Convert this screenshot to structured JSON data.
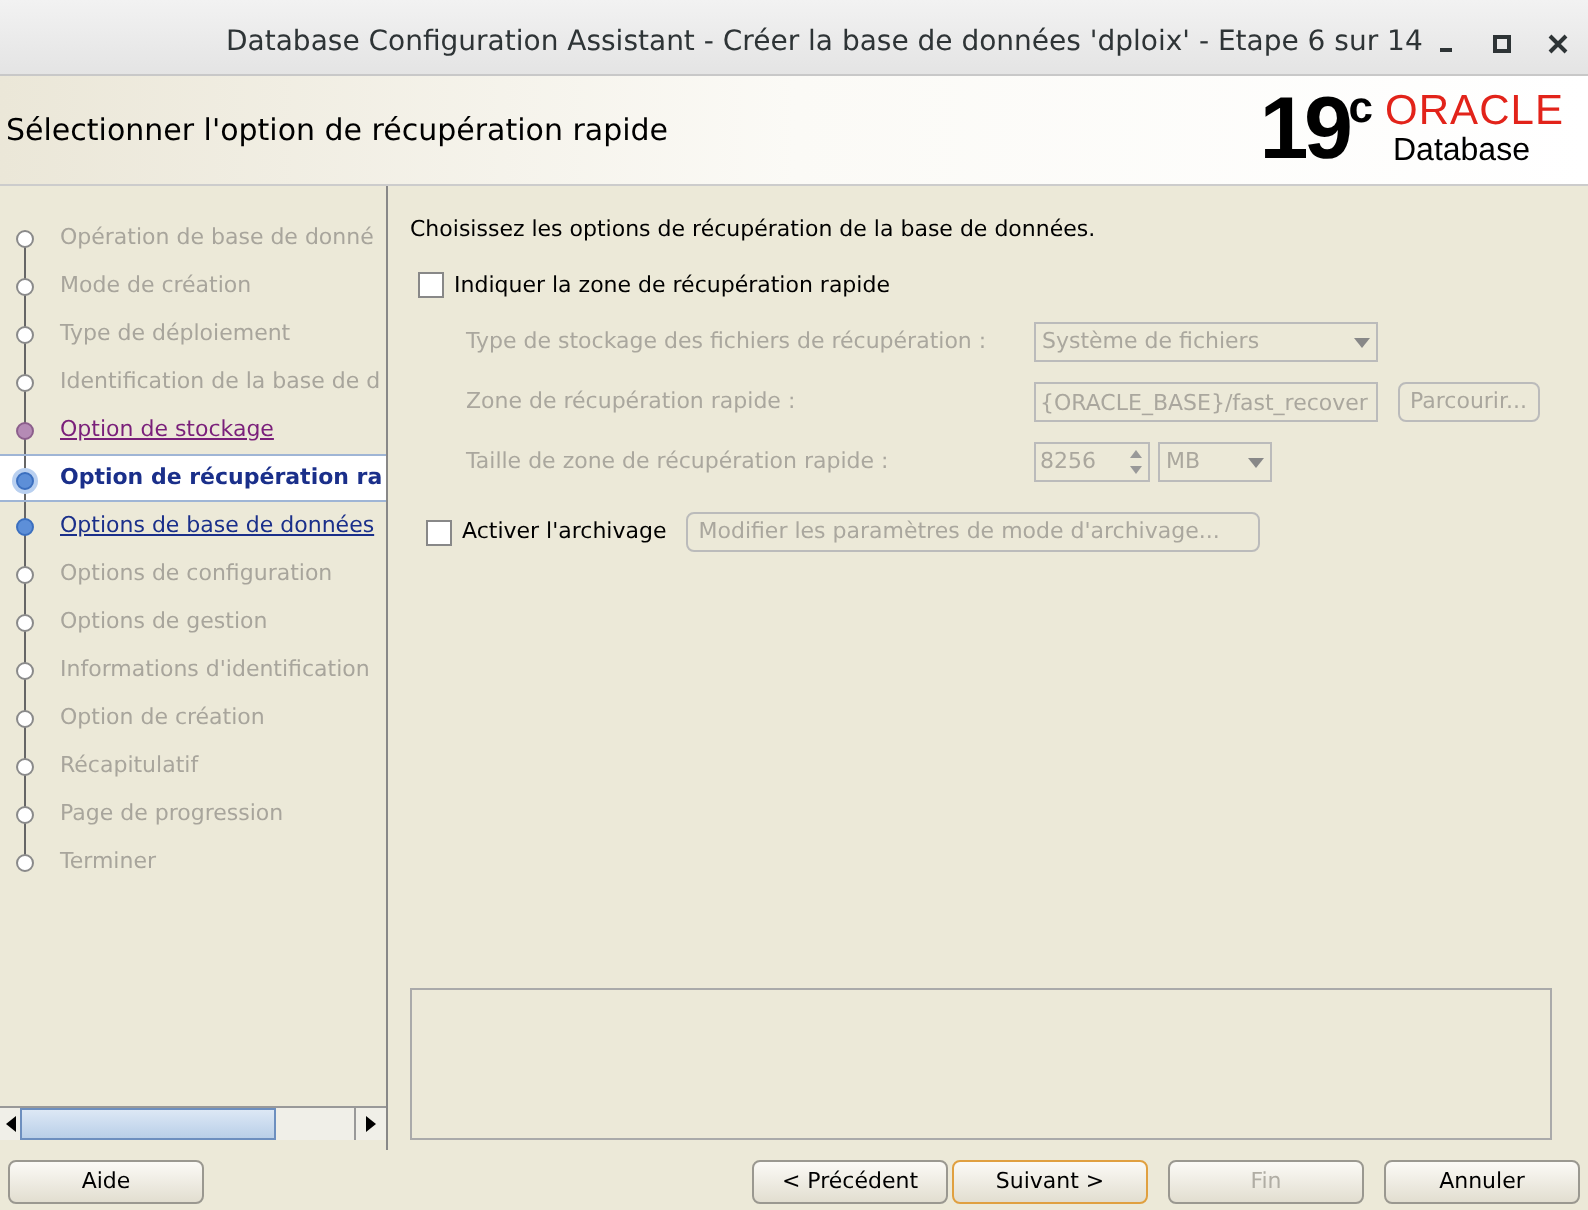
{
  "window": {
    "title": "Database Configuration Assistant - Créer la base de données 'dploix' - Etape 6 sur 14"
  },
  "header": {
    "title": "Sélectionner l'option de récupération rapide",
    "version": "19",
    "version_sup": "c",
    "brand": "ORACLE",
    "product": "Database"
  },
  "steps": [
    {
      "label": "Opération de base de donné",
      "selected": false,
      "visited": false,
      "available": false
    },
    {
      "label": "Mode de création",
      "selected": false,
      "visited": false,
      "available": false
    },
    {
      "label": "Type de déploiement",
      "selected": false,
      "visited": false,
      "available": false
    },
    {
      "label": "Identification de la base de d",
      "selected": false,
      "visited": false,
      "available": false
    },
    {
      "label": "Option de stockage",
      "selected": false,
      "visited": true,
      "available": true
    },
    {
      "label": "Option de récupération ra",
      "selected": true,
      "visited": false,
      "available": false
    },
    {
      "label": "Options de base de données",
      "selected": false,
      "visited": false,
      "available": true
    },
    {
      "label": "Options de configuration",
      "selected": false,
      "visited": false,
      "available": false
    },
    {
      "label": "Options de gestion",
      "selected": false,
      "visited": false,
      "available": false
    },
    {
      "label": "Informations d'identification",
      "selected": false,
      "visited": false,
      "available": false
    },
    {
      "label": "Option de création",
      "selected": false,
      "visited": false,
      "available": false
    },
    {
      "label": "Récapitulatif",
      "selected": false,
      "visited": false,
      "available": false
    },
    {
      "label": "Page de progression",
      "selected": false,
      "visited": false,
      "available": false
    },
    {
      "label": "Terminer",
      "selected": false,
      "visited": false,
      "available": false
    }
  ],
  "content": {
    "intro": "Choisissez les options de récupération de la base de données.",
    "fra_checkbox": {
      "label": "Indiquer la zone de récupération rapide",
      "checked": false
    },
    "storage_type": {
      "label": "Type de stockage des fichiers de récupération :",
      "value": "Système de fichiers",
      "disabled": true
    },
    "fra_location": {
      "label": "Zone de récupération rapide :",
      "value": "{ORACLE_BASE}/fast_recover",
      "button": "Parcourir...",
      "disabled": true
    },
    "fra_size": {
      "label": "Taille de zone de récupération rapide :",
      "value": "8256",
      "unit": "MB",
      "disabled": true
    },
    "archive_checkbox": {
      "label": "Activer l'archivage",
      "checked": false
    },
    "archive_button": {
      "label": "Modifier les paramètres de mode d'archivage...",
      "disabled": true
    }
  },
  "buttons": [
    {
      "label": "Aide",
      "disabled": false,
      "default": false
    },
    {
      "label": "< Précédent",
      "disabled": false,
      "default": false
    },
    {
      "label": "Suivant >",
      "disabled": false,
      "default": true
    },
    {
      "label": "Fin",
      "disabled": true,
      "default": false
    },
    {
      "label": "Annuler",
      "disabled": false,
      "default": false
    }
  ]
}
